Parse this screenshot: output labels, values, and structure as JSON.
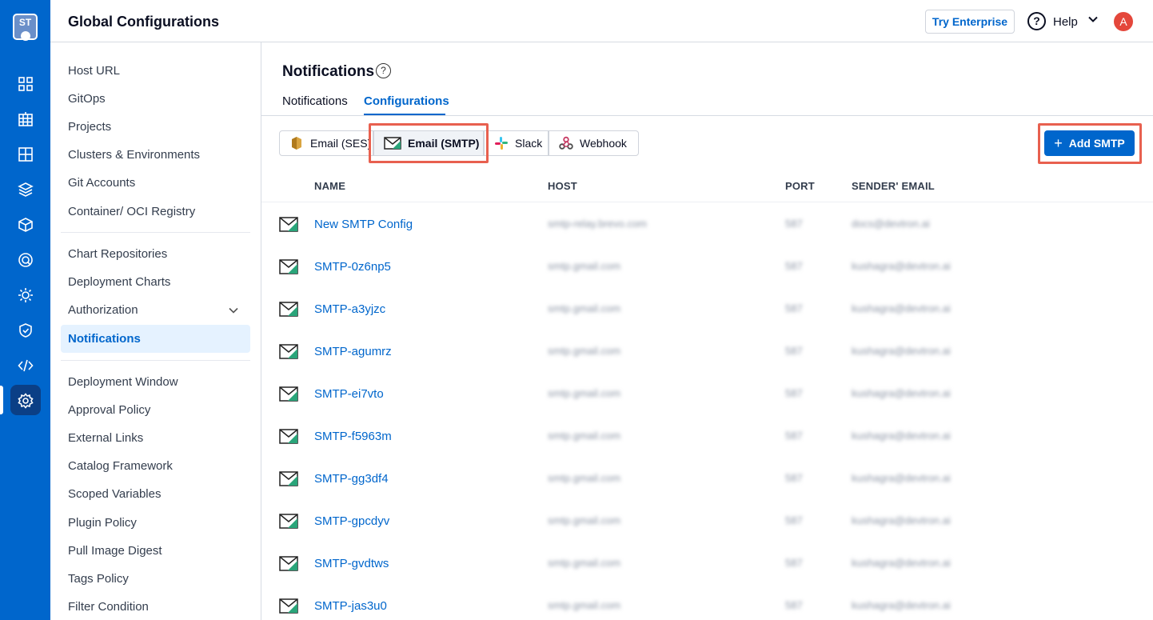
{
  "rail": {
    "logo_text": "ST",
    "icons": [
      "overview-icon",
      "applications-icon",
      "app-groups-icon",
      "chart-store-icon",
      "resource-browser-icon",
      "security-icon",
      "devtron-stack-icon",
      "policy-icon",
      "code-icon",
      "settings-icon"
    ]
  },
  "header": {
    "title": "Global Configurations",
    "try_enterprise": "Try Enterprise",
    "help_glyph": "?",
    "help_label": "Help",
    "avatar_initial": "A"
  },
  "sidebar": {
    "items": [
      "Host URL",
      "GitOps",
      "Projects",
      "Clusters & Environments",
      "Git Accounts",
      "Container/ OCI Registry",
      "Chart Repositories",
      "Deployment Charts",
      "Authorization",
      "Notifications",
      "Deployment Window",
      "Approval Policy",
      "External Links",
      "Catalog Framework",
      "Scoped Variables",
      "Plugin Policy",
      "Pull Image Digest",
      "Tags Policy",
      "Filter Condition"
    ],
    "active": "Notifications"
  },
  "main": {
    "section_title": "Notifications",
    "section_help_glyph": "?",
    "tabs": [
      "Notifications",
      "Configurations"
    ],
    "active_tab": "Configurations",
    "segments": [
      "Email (SES)",
      "Email (SMTP)",
      "Slack",
      "Webhook"
    ],
    "active_segment": "Email (SMTP)",
    "add_button": "Add SMTP",
    "add_glyph": "+",
    "columns": [
      "NAME",
      "HOST",
      "PORT",
      "SENDER' EMAIL"
    ],
    "rows": [
      {
        "name": "New SMTP Config",
        "host": "smtp-relay.brevo.com",
        "port": "587",
        "email": "docs@devtron.ai"
      },
      {
        "name": "SMTP-0z6np5",
        "host": "smtp.gmail.com",
        "port": "587",
        "email": "kushagra@devtron.ai"
      },
      {
        "name": "SMTP-a3yjzc",
        "host": "smtp.gmail.com",
        "port": "587",
        "email": "kushagra@devtron.ai"
      },
      {
        "name": "SMTP-agumrz",
        "host": "smtp.gmail.com",
        "port": "587",
        "email": "kushagra@devtron.ai"
      },
      {
        "name": "SMTP-ei7vto",
        "host": "smtp.gmail.com",
        "port": "587",
        "email": "kushagra@devtron.ai"
      },
      {
        "name": "SMTP-f5963m",
        "host": "smtp.gmail.com",
        "port": "587",
        "email": "kushagra@devtron.ai"
      },
      {
        "name": "SMTP-gg3df4",
        "host": "smtp.gmail.com",
        "port": "587",
        "email": "kushagra@devtron.ai"
      },
      {
        "name": "SMTP-gpcdyv",
        "host": "smtp.gmail.com",
        "port": "587",
        "email": "kushagra@devtron.ai"
      },
      {
        "name": "SMTP-gvdtws",
        "host": "smtp.gmail.com",
        "port": "587",
        "email": "kushagra@devtron.ai"
      },
      {
        "name": "SMTP-jas3u0",
        "host": "smtp.gmail.com",
        "port": "587",
        "email": "kushagra@devtron.ai"
      }
    ]
  },
  "colors": {
    "rail": "#0066cc",
    "accent": "#0066cc",
    "highlight": "#e8604f",
    "active_bg": "#e5f2ff"
  }
}
